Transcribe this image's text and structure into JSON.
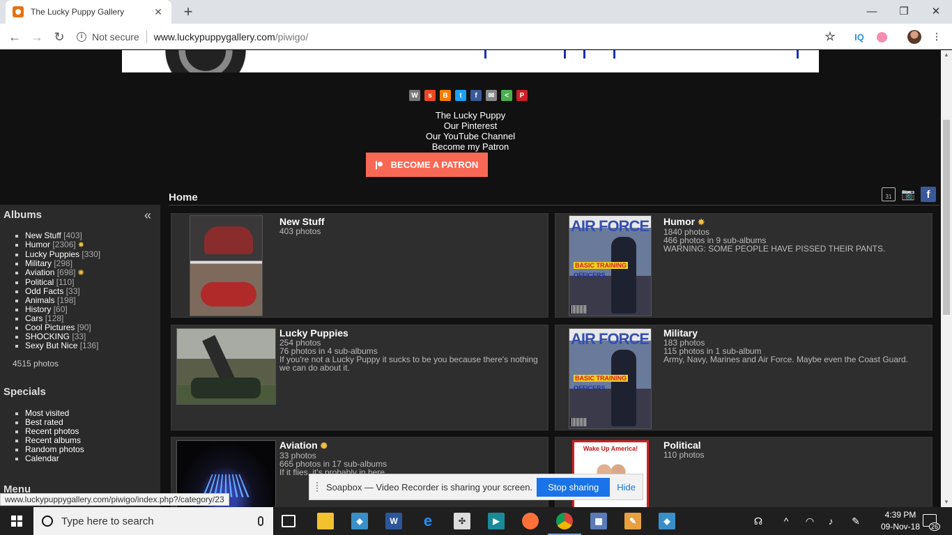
{
  "browser": {
    "tab_title": "The Lucky Puppy Gallery",
    "tab_close": "✕",
    "new_tab": "+",
    "security": "Not secure",
    "url_host": "www.luckypuppygallery.com",
    "url_path": "/piwigo/",
    "ext_iq": "IQ",
    "status_url": "www.luckypuppygallery.com/piwigo/index.php?/category/23"
  },
  "header": {
    "links": [
      "The Lucky Puppy",
      "Our Pinterest",
      "Our YouTube Channel",
      "Become my Patron"
    ],
    "patron_button": "BECOME A PATRON"
  },
  "home": {
    "title": "Home",
    "cal_day": "31"
  },
  "sidebar": {
    "albums_title": "Albums",
    "collapse": "«",
    "albums": [
      {
        "name": "New Stuff",
        "count": "[403]"
      },
      {
        "name": "Humor",
        "count": "[2306]"
      },
      {
        "name": "Lucky Puppies",
        "count": "[330]"
      },
      {
        "name": "Military",
        "count": "[298]"
      },
      {
        "name": "Aviation",
        "count": "[698]"
      },
      {
        "name": "Political",
        "count": "[110]"
      },
      {
        "name": "Odd Facts",
        "count": "[33]"
      },
      {
        "name": "Animals",
        "count": "[198]"
      },
      {
        "name": "History",
        "count": "[60]"
      },
      {
        "name": "Cars",
        "count": "[128]"
      },
      {
        "name": "Cool Pictures",
        "count": "[90]"
      },
      {
        "name": "SHOCKING",
        "count": "[33]"
      },
      {
        "name": "Sexy But Nice",
        "count": "[136]"
      }
    ],
    "total": "4515 photos",
    "specials_title": "Specials",
    "specials": [
      "Most visited",
      "Best rated",
      "Recent photos",
      "Recent albums",
      "Random photos",
      "Calendar"
    ],
    "menu_title": "Menu"
  },
  "albums": {
    "new_stuff": {
      "name": "New Stuff",
      "photos": "403 photos"
    },
    "humor": {
      "name": "Humor",
      "photos": "1840 photos",
      "sub": "466 photos in 9 sub-albums",
      "desc": "WARNING: SOME PEOPLE HAVE PISSED THEIR PANTS."
    },
    "lucky_puppies": {
      "name": "Lucky Puppies",
      "photos": "254 photos",
      "sub": "76 photos in 4 sub-albums",
      "desc": "If you're not a Lucky Puppy it sucks to be you because there's nothing we can do about it."
    },
    "military": {
      "name": "Military",
      "photos": "183 photos",
      "sub": "115 photos in 1 sub-album",
      "desc": "Army, Navy, Marines and Air Force. Maybe even the Coast Guard."
    },
    "aviation": {
      "name": "Aviation",
      "photos": "33 photos",
      "sub": "665 photos in 17 sub-albums",
      "desc": "If it flies, it's probably in here."
    },
    "political": {
      "name": "Political",
      "photos": "110 photos"
    }
  },
  "thumbs": {
    "af_title": "AIR FORCE",
    "af_basic": "BASIC TRAINING",
    "af_officers": "OFFICERS",
    "wake_title": "Wake Up America!"
  },
  "sharing": {
    "message": "Soapbox — Video Recorder is sharing your screen.",
    "stop": "Stop sharing",
    "hide": "Hide"
  },
  "taskbar": {
    "search_placeholder": "Type here to search",
    "time": "4:39 PM",
    "date": "09-Nov-18",
    "notifications": "26"
  },
  "colors": {
    "patron": "#f96854",
    "stop_button": "#1a73e8",
    "page_bg": "#111111"
  }
}
